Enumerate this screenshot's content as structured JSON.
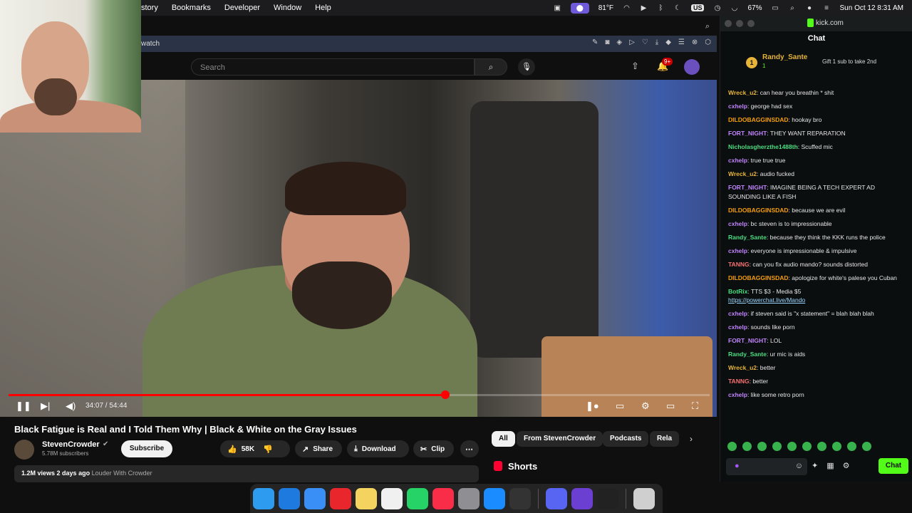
{
  "menubar": {
    "menus": [
      "story",
      "Bookmarks",
      "Developer",
      "Window",
      "Help"
    ],
    "temperature": "81°F",
    "battery": "67%",
    "keyboard": "US",
    "datetime": "Sun Oct 12  8:31 AM"
  },
  "browser": {
    "url_fragment": "watch",
    "search_placeholder": "Search",
    "notification_badge": "9+"
  },
  "player": {
    "time": "34:07 / 54:44",
    "progress": 0.623
  },
  "video": {
    "title": "Black Fatigue is Real and I Told Them Why | Black & White on the Gray Issues",
    "channel": "StevenCrowder",
    "subscribers": "5.78M subscribers",
    "subscribe": "Subscribe",
    "likes": "58K",
    "share": "Share",
    "download": "Download",
    "clip": "Clip",
    "views": "1.2M views",
    "age": "2 days ago",
    "desc_link": "Louder With Crowder"
  },
  "chips": [
    "All",
    "From StevenCrowder",
    "Podcasts",
    "Rela"
  ],
  "shorts": "Shorts",
  "kick": {
    "domain": "kick.com",
    "chat_title": "Chat",
    "pinned_user": "Randy_Sante",
    "pinned_count": "1",
    "pinned_gift": "Gift 1 sub to take 2nd",
    "chat_button": "Chat",
    "messages": [
      {
        "user": "Wreck_u2",
        "color": "#e7b339",
        "text": "can hear you breathin * shit"
      },
      {
        "user": "cxhelp",
        "color": "#c084fc",
        "text": "george had sex"
      },
      {
        "user": "DILDOBAGGINSDAD",
        "color": "#f59e0b",
        "text": "hookay bro"
      },
      {
        "user": "FORT_NIGHT",
        "color": "#c084fc",
        "text": "THEY WANT REPARATION"
      },
      {
        "user": "Nicholasgherzthe1488th",
        "color": "#4ade80",
        "text": "Scuffed mic"
      },
      {
        "user": "cxhelp",
        "color": "#c084fc",
        "text": "true true true"
      },
      {
        "user": "Wreck_u2",
        "color": "#e7b339",
        "text": "audio fucked"
      },
      {
        "user": "FORT_NIGHT",
        "color": "#c084fc",
        "text": "IMAGINE BEING A TECH EXPERT AD SOUNDING LIKE A FISH"
      },
      {
        "user": "DILDOBAGGINSDAD",
        "color": "#f59e0b",
        "text": "because we are evil"
      },
      {
        "user": "cxhelp",
        "color": "#c084fc",
        "text": "bc steven is to impressionable"
      },
      {
        "user": "Randy_Sante",
        "color": "#4ade80",
        "text": "because they think the KKK runs the police"
      },
      {
        "user": "cxhelp",
        "color": "#c084fc",
        "text": "everyone is impressionable & impulsive"
      },
      {
        "user": "TANNG",
        "color": "#f87171",
        "text": "can you fix audio mando? sounds distorted"
      },
      {
        "user": "DILDOBAGGINSDAD",
        "color": "#f59e0b",
        "text": "apologize for white's palese you Cuban"
      },
      {
        "user": "BotRix",
        "color": "#4ade80",
        "text": "TTS $3 - Media $5",
        "link": "https://powerchat.live/Mando"
      },
      {
        "user": "cxhelp",
        "color": "#c084fc",
        "text": "if steven said is \"x statement\" = blah blah blah"
      },
      {
        "user": "cxhelp",
        "color": "#c084fc",
        "text": "sounds like porn"
      },
      {
        "user": "FORT_NIGHT",
        "color": "#c084fc",
        "text": "LOL"
      },
      {
        "user": "Randy_Sante",
        "color": "#4ade80",
        "text": "ur mic is aids"
      },
      {
        "user": "Wreck_u2",
        "color": "#e7b339",
        "text": "better"
      },
      {
        "user": "TANNG",
        "color": "#f87171",
        "text": "better"
      },
      {
        "user": "cxhelp",
        "color": "#c084fc",
        "text": "like some retro porn"
      }
    ]
  }
}
